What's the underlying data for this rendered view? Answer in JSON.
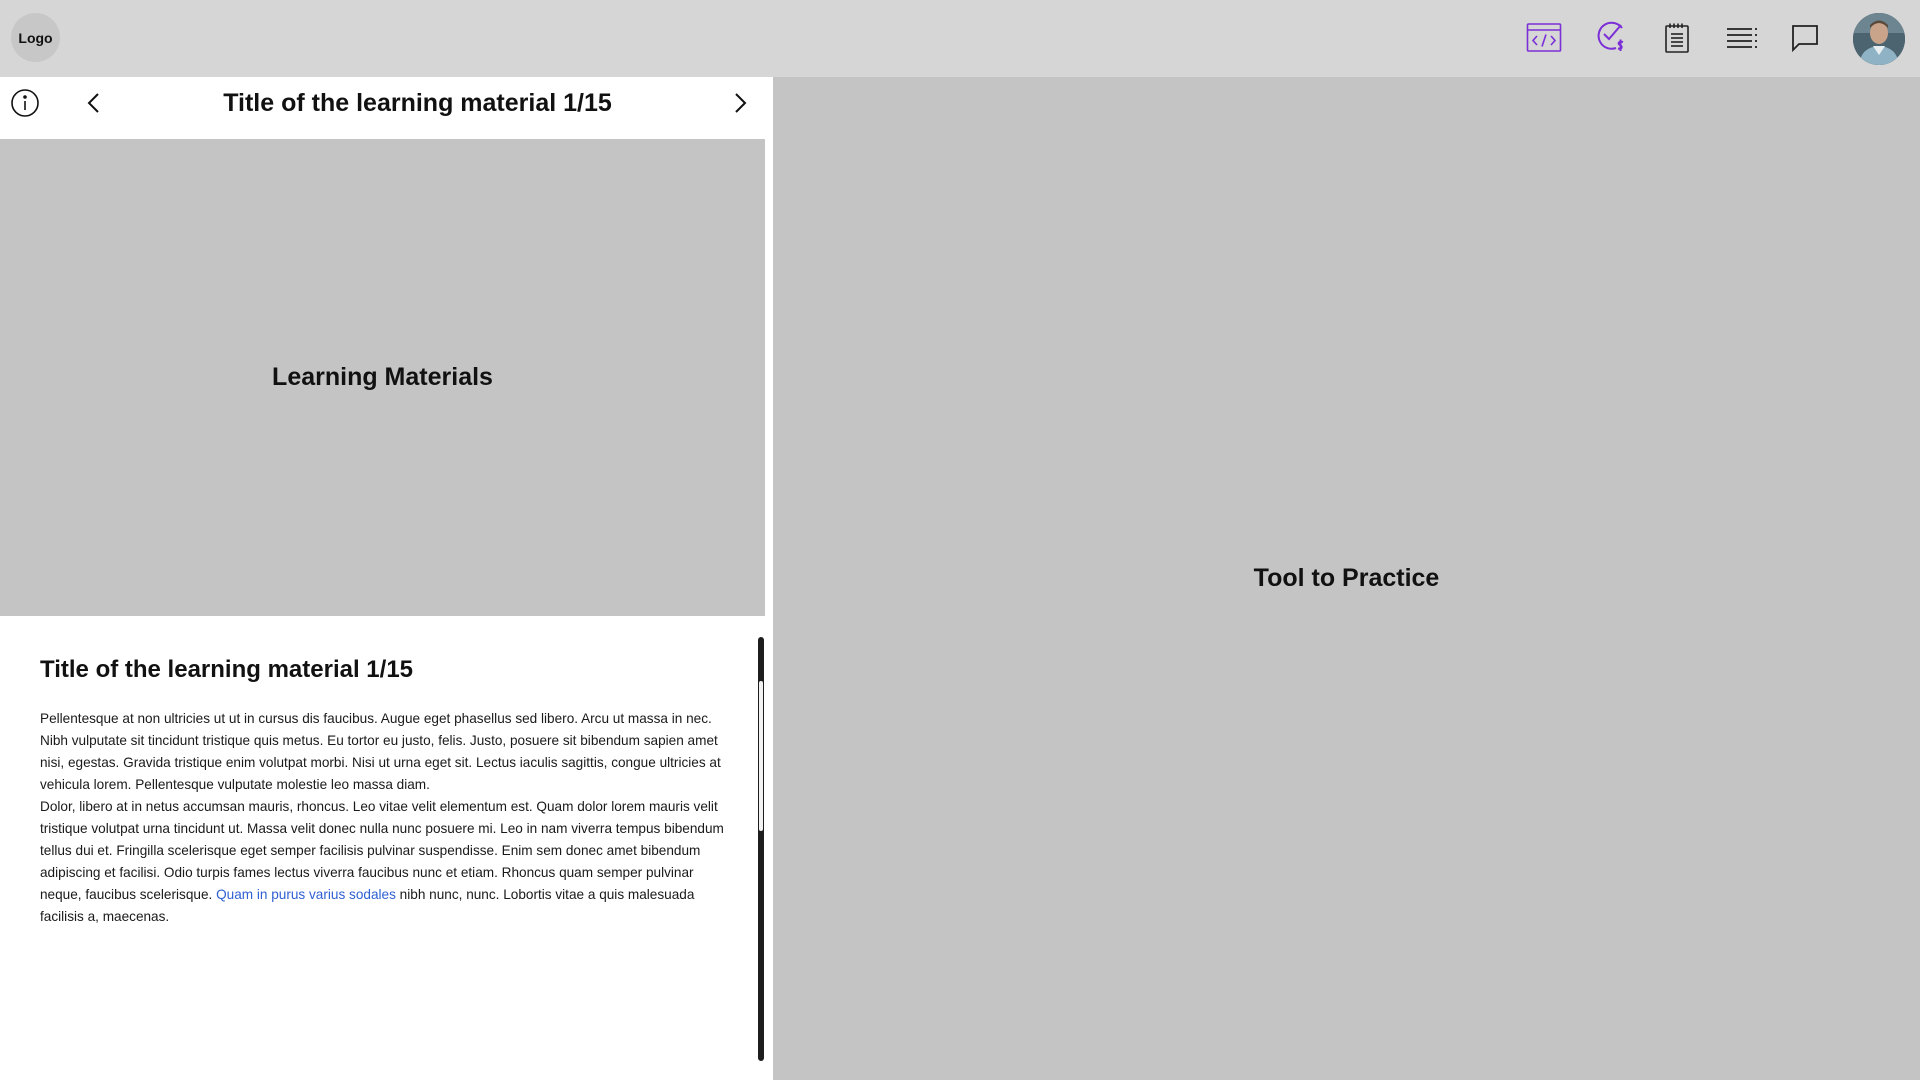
{
  "topbar": {
    "logo_label": "Logo",
    "icons": [
      {
        "name": "code-editor-icon",
        "color": "#7b2fd6"
      },
      {
        "name": "check-dollar-icon",
        "color": "#7b2fd6"
      },
      {
        "name": "notepad-icon",
        "color": "#222222"
      },
      {
        "name": "list-icon",
        "color": "#222222"
      },
      {
        "name": "chat-icon",
        "color": "#222222"
      }
    ]
  },
  "learning": {
    "header_title": "Title of the learning material 1/15",
    "media_label": "Learning Materials",
    "content_title": "Title of the learning material 1/15",
    "paragraph1": "Pellentesque at non ultricies ut ut in cursus dis faucibus. Augue eget phasellus sed libero. Arcu ut massa in nec. Nibh vulputate sit tincidunt tristique quis metus. Eu tortor eu justo, felis. Justo, posuere sit bibendum sapien amet nisi, egestas. Gravida tristique enim volutpat morbi. Nisi ut urna eget sit. Lectus iaculis sagittis, congue ultricies at vehicula lorem. Pellentesque vulputate molestie leo massa diam.",
    "paragraph2_before": "Dolor, libero at in netus accumsan mauris, rhoncus. Leo vitae velit elementum est. Quam dolor lorem mauris velit tristique volutpat urna tincidunt ut. Massa velit donec nulla nunc posuere mi. Leo in nam viverra tempus bibendum tellus dui et. Fringilla scelerisque eget semper facilisis pulvinar suspendisse. Enim sem donec amet bibendum adipiscing et facilisi. Odio turpis fames lectus viverra faucibus nunc et etiam. Rhoncus quam semper pulvinar neque, faucibus scelerisque. ",
    "link_text": "Quam in purus varius sodales",
    "paragraph2_after": " nibh nunc, nunc. Lobortis vitae a quis malesuada facilisis a, maecenas."
  },
  "practice": {
    "label": "Tool to Practice"
  }
}
